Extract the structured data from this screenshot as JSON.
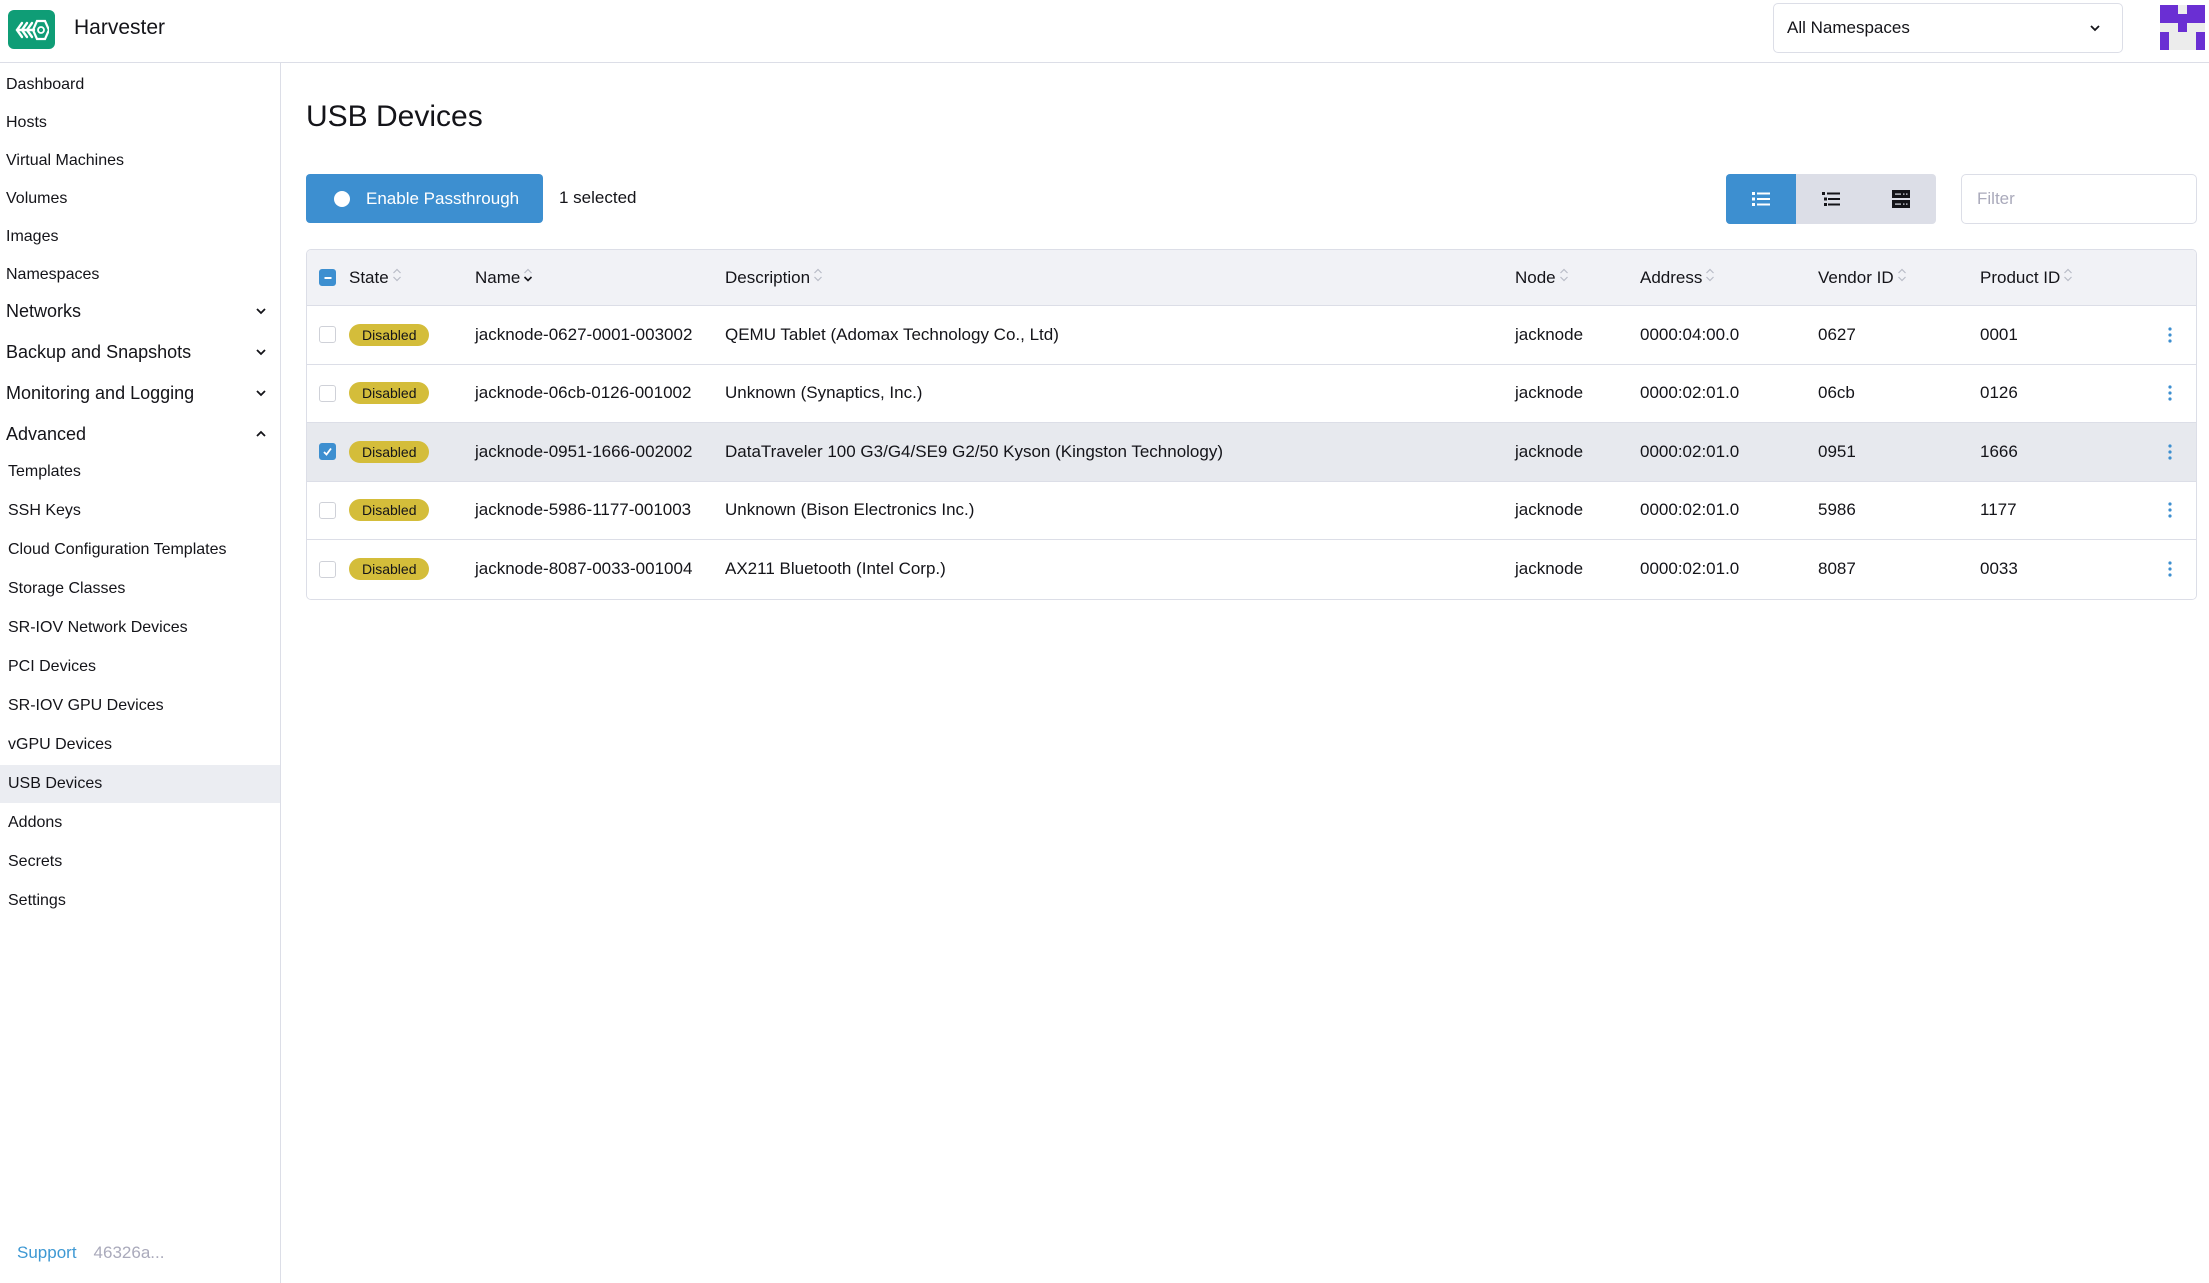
{
  "app": {
    "title": "Harvester",
    "namespace_select": {
      "value": "All Namespaces"
    },
    "brand_color": "#0f9d76",
    "accent_color": "#3d8fd0"
  },
  "sidebar": {
    "items": [
      {
        "label": "Dashboard",
        "type": "item"
      },
      {
        "label": "Hosts",
        "type": "item"
      },
      {
        "label": "Virtual Machines",
        "type": "item"
      },
      {
        "label": "Volumes",
        "type": "item"
      },
      {
        "label": "Images",
        "type": "item"
      },
      {
        "label": "Namespaces",
        "type": "item"
      },
      {
        "label": "Networks",
        "type": "group",
        "expanded": false
      },
      {
        "label": "Backup and Snapshots",
        "type": "group",
        "expanded": false
      },
      {
        "label": "Monitoring and Logging",
        "type": "group",
        "expanded": false
      },
      {
        "label": "Advanced",
        "type": "group",
        "expanded": true
      },
      {
        "label": "Templates",
        "type": "sub"
      },
      {
        "label": "SSH Keys",
        "type": "sub"
      },
      {
        "label": "Cloud Configuration Templates",
        "type": "sub"
      },
      {
        "label": "Storage Classes",
        "type": "sub"
      },
      {
        "label": "SR-IOV Network Devices",
        "type": "sub"
      },
      {
        "label": "PCI Devices",
        "type": "sub"
      },
      {
        "label": "SR-IOV GPU Devices",
        "type": "sub"
      },
      {
        "label": "vGPU Devices",
        "type": "sub"
      },
      {
        "label": "USB Devices",
        "type": "sub",
        "active": true
      },
      {
        "label": "Addons",
        "type": "sub"
      },
      {
        "label": "Secrets",
        "type": "sub"
      },
      {
        "label": "Settings",
        "type": "sub"
      }
    ],
    "footer": {
      "support_label": "Support",
      "version": "46326a..."
    }
  },
  "main": {
    "title": "USB Devices",
    "enable_button_label": "Enable Passthrough",
    "selected_text": "1 selected",
    "filter": {
      "placeholder": "Filter",
      "value": ""
    },
    "view_modes": [
      {
        "icon": "flat-list-icon",
        "active": true
      },
      {
        "icon": "nested-list-icon",
        "active": false
      },
      {
        "icon": "grouped-rows-icon",
        "active": false
      }
    ],
    "table": {
      "columns": [
        "State",
        "Name",
        "Description",
        "Node",
        "Address",
        "Vendor ID",
        "Product ID"
      ],
      "sorted_column": "Name",
      "rows": [
        {
          "state": "Disabled",
          "name": "jacknode-0627-0001-003002",
          "description": "QEMU Tablet (Adomax Technology Co., Ltd)",
          "node": "jacknode",
          "address": "0000:04:00.0",
          "vendor_id": "0627",
          "product_id": "0001",
          "selected": false
        },
        {
          "state": "Disabled",
          "name": "jacknode-06cb-0126-001002",
          "description": "Unknown (Synaptics, Inc.)",
          "node": "jacknode",
          "address": "0000:02:01.0",
          "vendor_id": "06cb",
          "product_id": "0126",
          "selected": false
        },
        {
          "state": "Disabled",
          "name": "jacknode-0951-1666-002002",
          "description": "DataTraveler 100 G3/G4/SE9 G2/50 Kyson (Kingston Technology)",
          "node": "jacknode",
          "address": "0000:02:01.0",
          "vendor_id": "0951",
          "product_id": "1666",
          "selected": true
        },
        {
          "state": "Disabled",
          "name": "jacknode-5986-1177-001003",
          "description": "Unknown (Bison Electronics Inc.)",
          "node": "jacknode",
          "address": "0000:02:01.0",
          "vendor_id": "5986",
          "product_id": "1177",
          "selected": false
        },
        {
          "state": "Disabled",
          "name": "jacknode-8087-0033-001004",
          "description": "AX211 Bluetooth (Intel Corp.)",
          "node": "jacknode",
          "address": "0000:02:01.0",
          "vendor_id": "8087",
          "product_id": "0033",
          "selected": false
        }
      ]
    }
  }
}
